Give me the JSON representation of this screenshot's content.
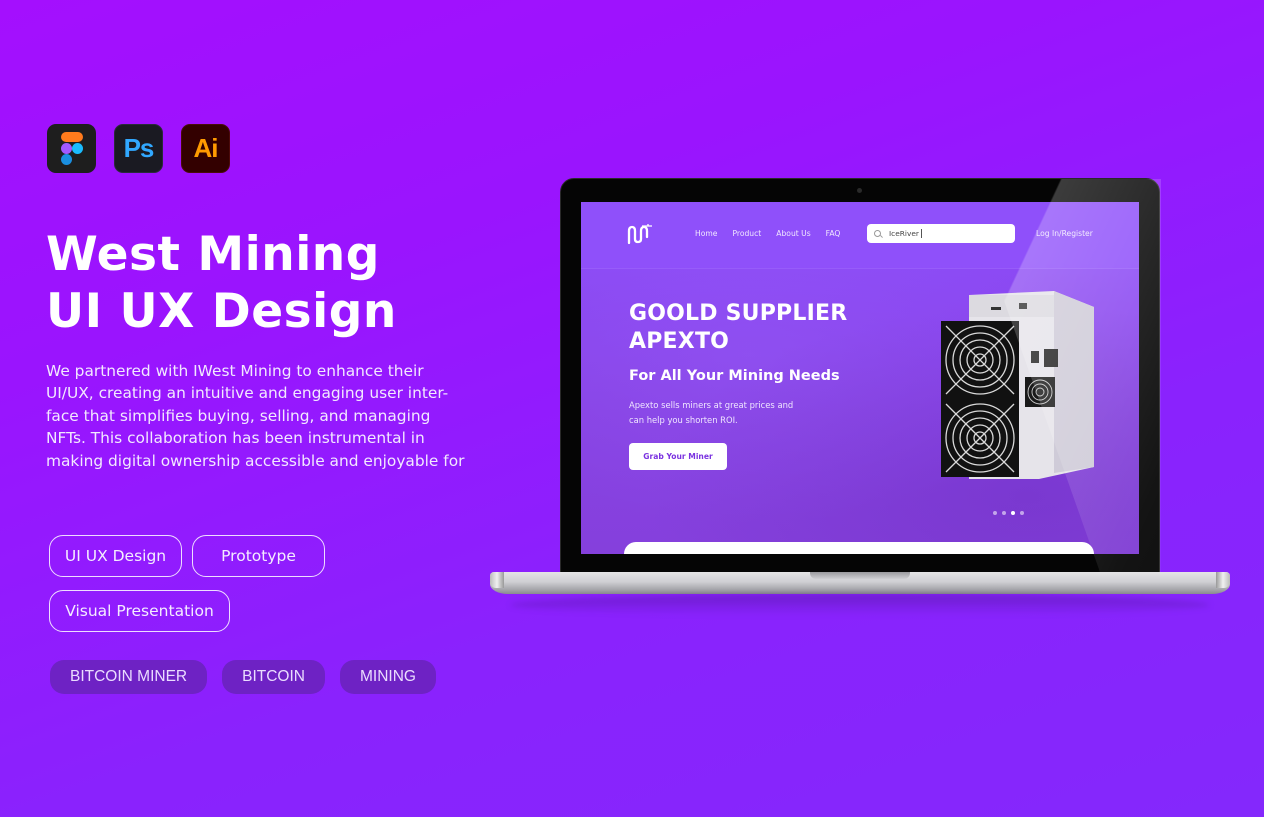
{
  "tools": [
    {
      "name": "Figma",
      "icon": "figma-icon"
    },
    {
      "name": "Photoshop",
      "label": "Ps",
      "icon": "photoshop-icon",
      "color": "#31a8ff"
    },
    {
      "name": "Illustrator",
      "label": "Ai",
      "icon": "illustrator-icon",
      "color": "#ff9a00"
    }
  ],
  "title": {
    "line1": "West Mining",
    "line2": "UI UX Design"
  },
  "description": {
    "lines": [
      "We partnered with IWest Mining to enhance their",
      "UI/UX, creating an intuitive and engaging user inter-",
      "face that simplifies buying, selling, and managing",
      "NFTs. This collaboration has been instrumental in",
      "making digital ownership accessible and enjoyable for"
    ]
  },
  "skill_tags": [
    "UI UX Design",
    "Prototype",
    "Visual Presentation"
  ],
  "keyword_tags": [
    "BITCOIN MINER",
    "BITCOIN",
    "MINING"
  ],
  "mockup": {
    "nav": [
      "Home",
      "Product",
      "About Us",
      "FAQ"
    ],
    "search": {
      "value": "IceRiver"
    },
    "login_label": "Log In/Register",
    "hero": {
      "title_line1": "GOOLD SUPPLIER",
      "title_line2": "APEXTO",
      "subtitle": "For All Your Mining Needs",
      "text_line1": "Apexto sells miners at great prices and",
      "text_line2": "can help you shorten ROI.",
      "cta_label": "Grab Your Miner"
    },
    "carousel": {
      "count": 4,
      "active_index": 2
    }
  },
  "colors": {
    "background_top": "#a40ffe",
    "background_bottom": "#8428fc",
    "keyword_tag_bg": "#6e22c4",
    "site_header": "#8f50fa",
    "cta_text": "#7b33e0"
  }
}
